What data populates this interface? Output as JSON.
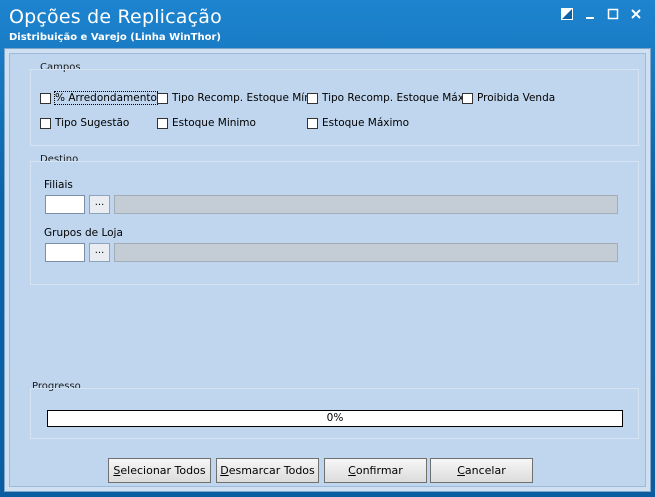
{
  "window": {
    "title": "Opções de Replicação",
    "subtitle": "Distribuição e Varejo (Linha WinThor)"
  },
  "campos": {
    "label": "Campos",
    "checkboxes": [
      {
        "label": "% Arredondamento",
        "checked": false
      },
      {
        "label": "Tipo Recomp. Estoque Mín.",
        "checked": false
      },
      {
        "label": "Tipo Recomp. Estoque Máx.",
        "checked": false
      },
      {
        "label": "Proibida Venda",
        "checked": false
      },
      {
        "label": "Tipo Sugestão",
        "checked": false
      },
      {
        "label": "Estoque Minimo",
        "checked": false
      },
      {
        "label": "Estoque Máximo",
        "checked": false
      }
    ]
  },
  "destino": {
    "label": "Destino",
    "filiais": {
      "label": "Filiais",
      "value": "",
      "description": "",
      "lookup": "..."
    },
    "grupos": {
      "label": "Grupos de Loja",
      "value": "",
      "description": "",
      "lookup": "..."
    }
  },
  "progresso": {
    "label": "Progresso",
    "value_text": "0%",
    "fraction": 0
  },
  "buttons": {
    "select_all": {
      "mnemonic": "S",
      "rest": "elecionar Todos"
    },
    "deselect_all": {
      "mnemonic": "D",
      "rest": "esmarcar Todos"
    },
    "confirm": {
      "mnemonic": "C",
      "rest": "onfirmar"
    },
    "cancel": {
      "mnemonic": "C",
      "rest": "ancelar"
    }
  }
}
